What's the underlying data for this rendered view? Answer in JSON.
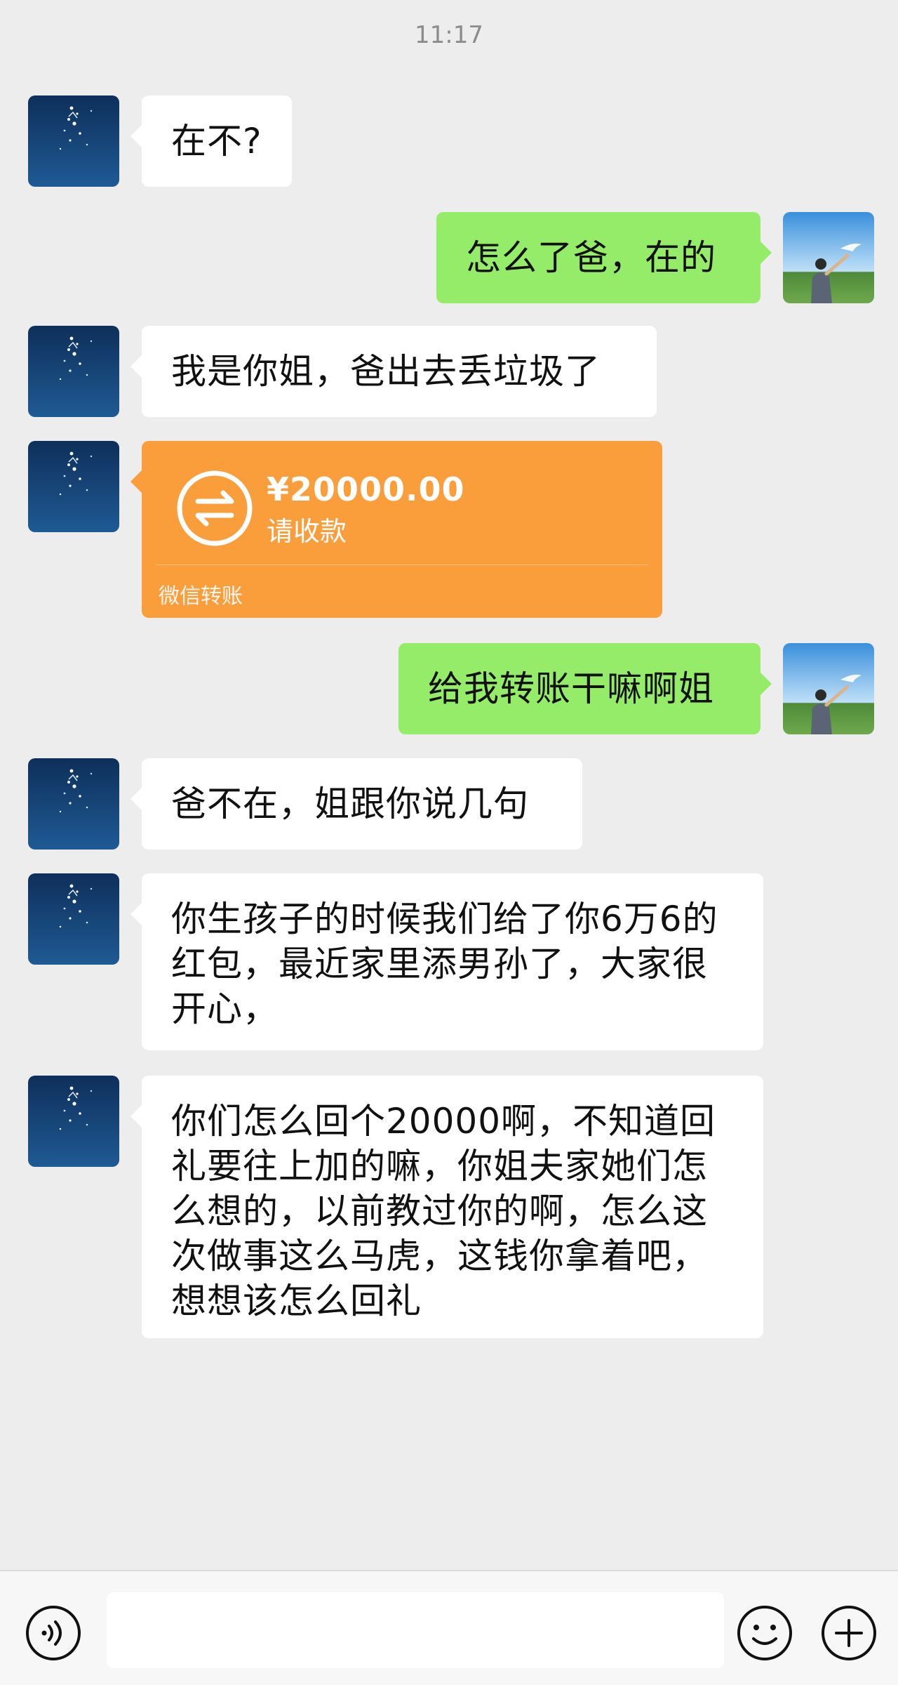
{
  "status_bar": {
    "time": "11:17"
  },
  "messages": [
    {
      "side": "left",
      "text": "在不?"
    },
    {
      "side": "right",
      "text": "怎么了爸，在的"
    },
    {
      "side": "left",
      "text": "我是你姐，爸出去丢垃圾了"
    },
    {
      "side": "left",
      "type": "transfer",
      "amount": "¥20000.00",
      "status": "请收款",
      "footer": "微信转账"
    },
    {
      "side": "right",
      "text": "给我转账干嘛啊姐"
    },
    {
      "side": "left",
      "text": "爸不在，姐跟你说几句"
    },
    {
      "side": "left",
      "text": "你生孩子的时候我们给了你6万6的红包，最近家里添男孙了，大家很开心，"
    },
    {
      "side": "left",
      "text": "你们怎么回个20000啊，不知道回礼要往上加的嘛，你姐夫家她们怎么想的，以前教过你的啊，怎么这次做事这么马虎，这钱你拿着吧，想想该怎么回礼"
    }
  ],
  "input_bar": {
    "voice_icon": "voice-icon",
    "emoji_icon": "emoji-icon",
    "plus_icon": "plus-icon"
  },
  "colors": {
    "background": "#ededed",
    "bubble_left": "#ffffff",
    "bubble_right": "#95ec69",
    "transfer": "#fa9d3b"
  }
}
